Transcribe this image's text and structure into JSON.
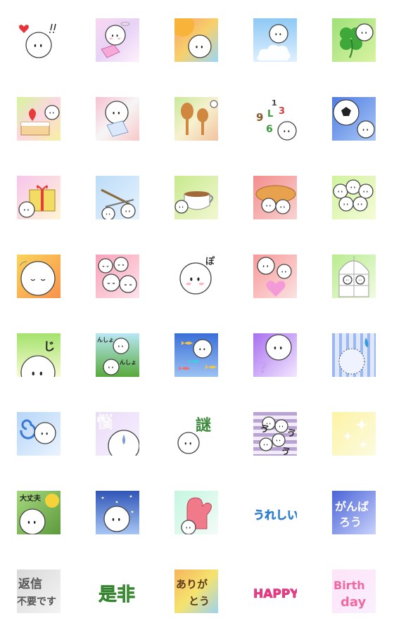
{
  "cells": [
    {
      "bg": "none",
      "marks": [
        "heart",
        "exclaim"
      ]
    },
    {
      "bg": "linear-gradient(135deg,#f9d7f1,#e7d3f7,#fff1fb)",
      "marks": [
        "halo",
        "blush",
        "ribbon"
      ]
    },
    {
      "bg": "linear-gradient(135deg,#f9a26b,#f7d06b,#9ad7f7)",
      "marks": [
        "sun"
      ]
    },
    {
      "bg": "linear-gradient(180deg,#8ec8f4,#dff0ff)",
      "marks": [
        "cloud"
      ]
    },
    {
      "bg": "linear-gradient(135deg,#9fe07a,#d9f3a2)",
      "marks": [
        "clover"
      ]
    },
    {
      "bg": "linear-gradient(135deg,#d5f59a,#fcd7e2,#f6f0a0)",
      "marks": [
        "cake"
      ]
    },
    {
      "bg": "linear-gradient(135deg,#f7c0d0,#f6f6f6,#f9c7c7)",
      "marks": [
        "letter"
      ]
    },
    {
      "bg": "linear-gradient(135deg,#c7ea9a,#f7f1d0,#f2c3a0)",
      "marks": [
        "spoons"
      ]
    },
    {
      "bg": "none",
      "text": [
        "9",
        "L",
        "3",
        "1",
        "6"
      ],
      "marks": [
        "digits"
      ]
    },
    {
      "bg": "linear-gradient(135deg,#4f7be0,#a8c8f7)",
      "marks": [
        "ball"
      ]
    },
    {
      "bg": "linear-gradient(135deg,#f7c5ec,#fff5d6)",
      "marks": [
        "gift"
      ]
    },
    {
      "bg": "linear-gradient(135deg,#bcdcf7,#e7f3ff)",
      "marks": [
        "cutlery"
      ]
    },
    {
      "bg": "linear-gradient(135deg,#c8ea8e,#f2f7d2)",
      "marks": [
        "cup"
      ]
    },
    {
      "bg": "linear-gradient(135deg,#f48d8d,#f9d2d2)",
      "marks": [
        "bread"
      ]
    },
    {
      "bg": "linear-gradient(135deg,#d1f39e,#f5fbd7)",
      "marks": [
        "cluster"
      ]
    },
    {
      "bg": "linear-gradient(135deg,#fbd45a,#f8924d)",
      "marks": [
        "sleepy"
      ]
    },
    {
      "bg": "linear-gradient(135deg,#f9a1b8,#fde3ea)",
      "marks": [
        "sleep-group"
      ]
    },
    {
      "bg": "none",
      "text": [
        "ぽ"
      ],
      "marks": [
        "po"
      ]
    },
    {
      "bg": "linear-gradient(135deg,#f89898,#fbe2e2)",
      "marks": [
        "pinkheart"
      ]
    },
    {
      "bg": "linear-gradient(135deg,#b9ec8f,#f0fbe1)",
      "marks": [
        "window"
      ]
    },
    {
      "bg": "linear-gradient(180deg,#a4e26d,#f7fbd2)",
      "text": [
        "じ"
      ],
      "marks": [
        "ji"
      ]
    },
    {
      "bg": "linear-gradient(180deg,#b9e8f5,#57a93a)",
      "text": [
        "んしょ",
        "んしょ"
      ],
      "marks": [
        "climb"
      ]
    },
    {
      "bg": "linear-gradient(180deg,#3a6fd8,#9bc2f3)",
      "marks": [
        "fish"
      ]
    },
    {
      "bg": "linear-gradient(135deg,#a86ff0,#f2e7ff)",
      "text": [
        "?"
      ],
      "marks": [
        "question"
      ]
    },
    {
      "bg": "repeating-linear-gradient(90deg,#9bb8ef 0 4px,#dfe8fb 4px 10px)",
      "marks": [
        "sweat"
      ]
    },
    {
      "bg": "linear-gradient(135deg,#b6d6f7,#eaf3ff)",
      "marks": [
        "spiral"
      ]
    },
    {
      "bg": "linear-gradient(135deg,#eadcf7,#f7f0ff)",
      "text": [
        "悩"
      ],
      "marks": [
        "nayami"
      ]
    },
    {
      "bg": "none",
      "text": [
        "謎"
      ],
      "marks": [
        "nazo"
      ]
    },
    {
      "bg": "repeating-linear-gradient(180deg,#b9a3d3 0 5px,#f1ecf7 5px 10px)",
      "text": [
        "ゔ",
        "ゔ",
        "ゔ"
      ],
      "marks": [
        "vu"
      ]
    },
    {
      "bg": "linear-gradient(135deg,#fdf3a6,#fbfbe0)",
      "marks": [
        "sparkle"
      ]
    },
    {
      "bg": "linear-gradient(135deg,#a7d97f,#5c9a3c)",
      "text": [
        "大丈夫"
      ],
      "marks": [
        "daijoubu"
      ]
    },
    {
      "bg": "linear-gradient(180deg,#2f55b8,#a8c6f3)",
      "marks": [
        "night"
      ]
    },
    {
      "bg": "linear-gradient(135deg,#c5f6e1,#f2fcf7)",
      "marks": [
        "mitten"
      ]
    },
    {
      "bg": "none",
      "text": [
        "うれしい"
      ],
      "marks": [
        "ureshii"
      ]
    },
    {
      "bg": "linear-gradient(135deg,#4a63d8,#c9d2fb)",
      "text": [
        "がんば",
        "ろう"
      ],
      "marks": [
        "ganbarou"
      ]
    },
    {
      "bg": "linear-gradient(135deg,#d9d9d9,#f4f4f4)",
      "text": [
        "返信",
        "不要です"
      ],
      "marks": [
        "henshin"
      ]
    },
    {
      "bg": "none",
      "text": [
        "是非"
      ],
      "marks": [
        "zehi"
      ]
    },
    {
      "bg": "linear-gradient(135deg,#f7b45a,#f5e36f,#9dd3f0)",
      "text": [
        "ありが",
        "とう"
      ],
      "marks": [
        "arigatou"
      ]
    },
    {
      "bg": "none",
      "text": [
        "HAPPY"
      ],
      "marks": [
        "happy"
      ]
    },
    {
      "bg": "linear-gradient(135deg,#ffe3f7,#f9f0ff)",
      "text": [
        "Birth",
        "day"
      ],
      "marks": [
        "birthday"
      ]
    }
  ]
}
